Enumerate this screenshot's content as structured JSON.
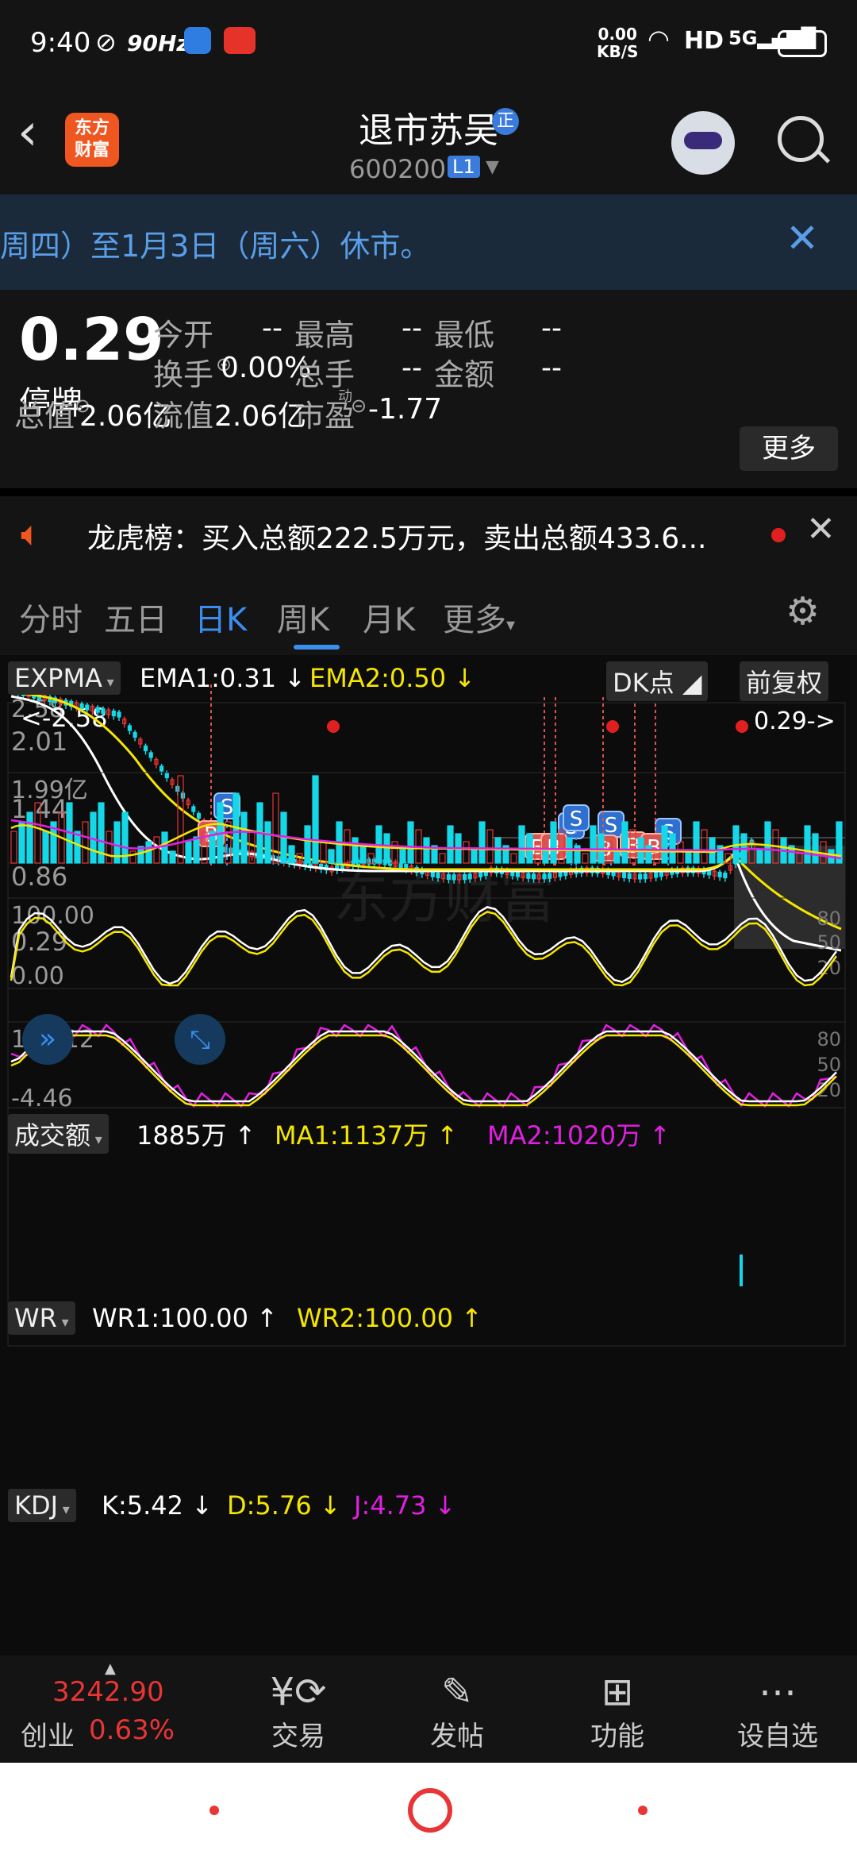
{
  "status": {
    "time": "9:40",
    "hz": "90Hz",
    "net_speed": "0.00",
    "net_unit": "KB/S",
    "hd": "HD",
    "signal": "5G",
    "battery": "96"
  },
  "header": {
    "logo_line1": "东方",
    "logo_line2": "财富",
    "title": "退市苏吴",
    "title_tag": "正",
    "code": "600200",
    "level": "L1"
  },
  "notice": {
    "text": "周四）至1月3日（周六）休市。"
  },
  "quote": {
    "price": "0.29",
    "state": "停牌",
    "fields": [
      {
        "label": "今开",
        "value": "--"
      },
      {
        "label": "最高",
        "value": "--"
      },
      {
        "label": "最低",
        "value": "--"
      },
      {
        "label": "换手",
        "value": "0.00%"
      },
      {
        "label": "总手",
        "value": "--"
      },
      {
        "label": "金额",
        "value": "--"
      },
      {
        "label": "总值",
        "value": "2.06亿"
      },
      {
        "label": "流值",
        "value": "2.06亿"
      },
      {
        "label": "市盈",
        "value": "-1.77"
      }
    ],
    "pe_superscript": "动",
    "more_label": "更多"
  },
  "dragon": {
    "text": "龙虎榜：买入总额222.5万元，卖出总额433.6..."
  },
  "tabs": [
    "分时",
    "五日",
    "日K",
    "周K",
    "月K",
    "更多"
  ],
  "active_tab": "日K",
  "chart": {
    "main_indicator": "EXPMA",
    "ema1": "EMA1:0.31",
    "ema2": "EMA2:0.50",
    "dk_label": "DK点",
    "adjust_label": "前复权",
    "y_ticks": [
      "2.01",
      "1.44",
      "0.86",
      "0.29"
    ],
    "max_label": "<-2.58",
    "top_partial": "2.58",
    "last_label": "0.29->",
    "watermark": "东方财富",
    "s_marker": "S",
    "b_marker": "B",
    "volume": {
      "name": "成交额",
      "value": "1885万",
      "ma1": "MA1:1137万",
      "ma2": "MA2:1020万",
      "max_tick": "1.99亿"
    },
    "wr": {
      "name": "WR",
      "wr1": "WR1:100.00",
      "wr2": "WR2:100.00",
      "ticks": [
        "100.00",
        "0.00"
      ],
      "right_ticks": [
        "80",
        "50",
        "20"
      ]
    },
    "kdj": {
      "name": "KDJ",
      "k": "K:5.42",
      "d": "D:5.76",
      "j": "J:4.73",
      "ticks": [
        "104.12",
        "-4.46"
      ],
      "right_ticks": [
        "80",
        "50",
        "20"
      ]
    },
    "colors": {
      "up": "#e83535",
      "down": "#14d8e8",
      "ema1": "#ffffff",
      "ema2": "#f5e600",
      "ma2": "#e020e0",
      "blue": "#3b8ef0"
    }
  },
  "bottom": {
    "index_name": "创业",
    "index_value": "3242.90",
    "index_change": "0.63%",
    "items": [
      {
        "label": "交易"
      },
      {
        "label": "发帖"
      },
      {
        "label": "功能"
      },
      {
        "label": "设自选"
      }
    ]
  }
}
